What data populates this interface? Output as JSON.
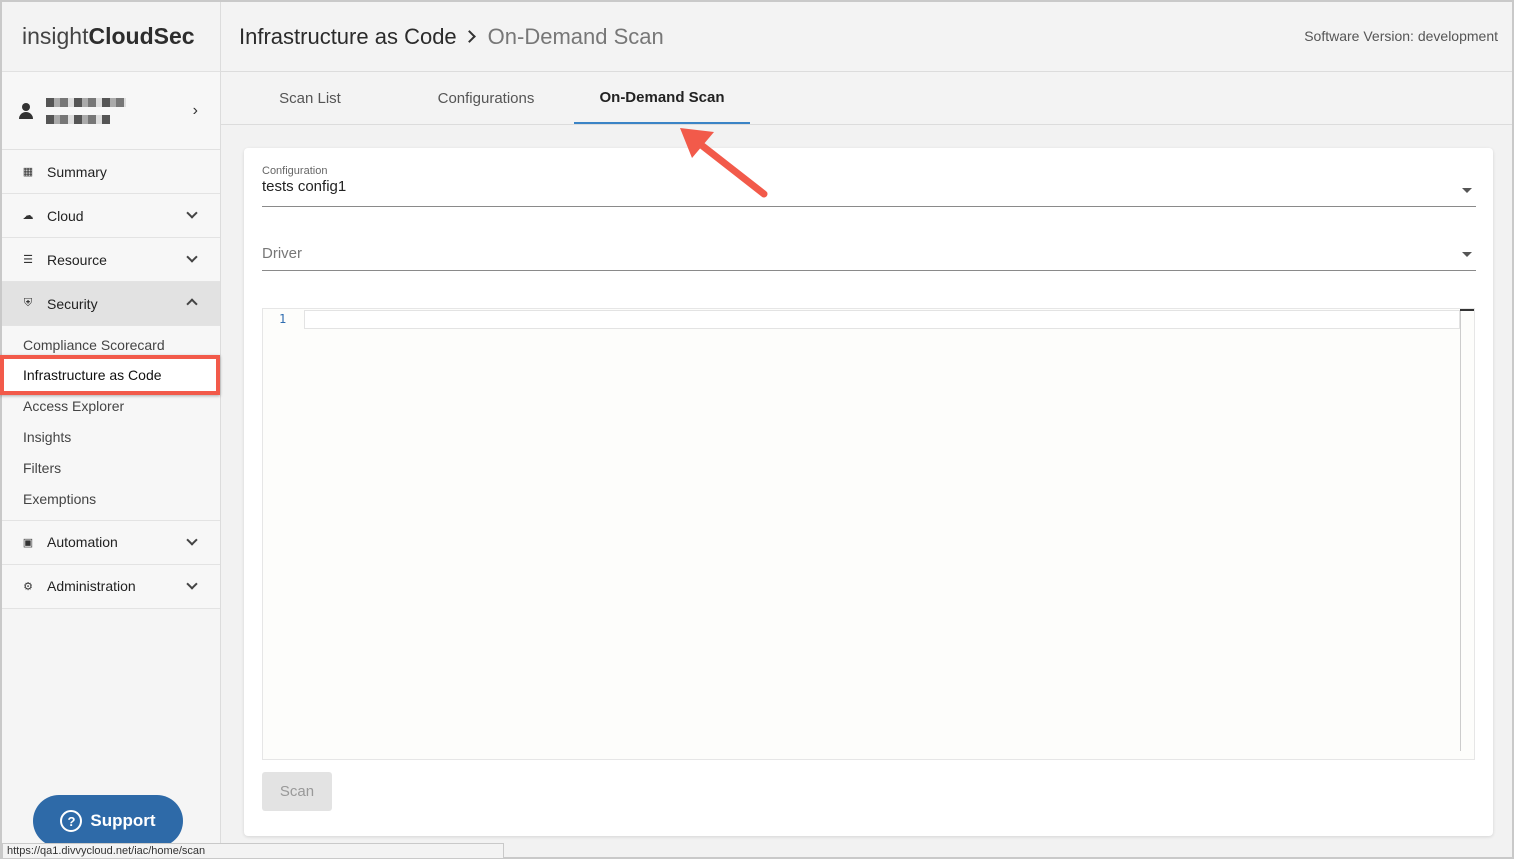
{
  "app": {
    "logo_light": "insight",
    "logo_bold": "CloudSec",
    "software_version": "Software Version: development"
  },
  "breadcrumb": {
    "section": "Infrastructure as Code",
    "page": "On-Demand Scan"
  },
  "sidebar": {
    "items": [
      {
        "label": "Summary",
        "icon": "dashboard-icon"
      },
      {
        "label": "Cloud",
        "icon": "cloud-icon"
      },
      {
        "label": "Resource",
        "icon": "list-icon"
      },
      {
        "label": "Security",
        "icon": "shield-icon"
      },
      {
        "label": "Automation",
        "icon": "lock-icon"
      },
      {
        "label": "Administration",
        "icon": "gear-icon"
      }
    ],
    "security_sub": [
      "Compliance Scorecard",
      "Infrastructure as Code",
      "Access Explorer",
      "Insights",
      "Filters",
      "Exemptions"
    ]
  },
  "tabs": [
    "Scan List",
    "Configurations",
    "On-Demand Scan"
  ],
  "form": {
    "configuration_label": "Configuration",
    "configuration_value": "tests config1",
    "driver_placeholder": "Driver",
    "editor_line_number": "1",
    "scan_button": "Scan"
  },
  "support_label": "Support",
  "status_url": "https://qa1.divvycloud.net/iac/home/scan",
  "colors": {
    "accent": "#3b84c6",
    "highlight": "#f25a4a",
    "support": "#2e6aa8"
  }
}
